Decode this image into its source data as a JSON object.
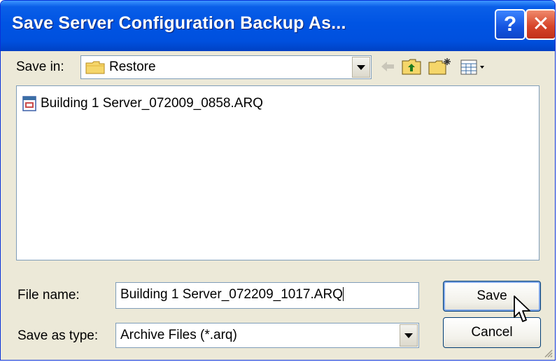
{
  "window": {
    "title": "Save Server Configuration Backup As...",
    "help_label": "?",
    "close_label": "✕"
  },
  "save_in": {
    "label": "Save in:",
    "folder": "Restore"
  },
  "toolbar": {
    "icons": [
      "back-arrow-icon",
      "up-folder-icon",
      "new-folder-icon",
      "view-menu-icon"
    ]
  },
  "files": [
    {
      "name": "Building 1 Server_072009_0858.ARQ",
      "icon": "archive-file-icon"
    }
  ],
  "file_name": {
    "label": "File name:",
    "value": "Building 1 Server_072209_1017.ARQ"
  },
  "save_as_type": {
    "label": "Save as type:",
    "value": "Archive Files (*.arq)"
  },
  "buttons": {
    "save": "Save",
    "cancel": "Cancel"
  },
  "colors": {
    "titlebar": "#0054e3",
    "dialog_bg": "#ece9d8",
    "border": "#7f9db9"
  }
}
